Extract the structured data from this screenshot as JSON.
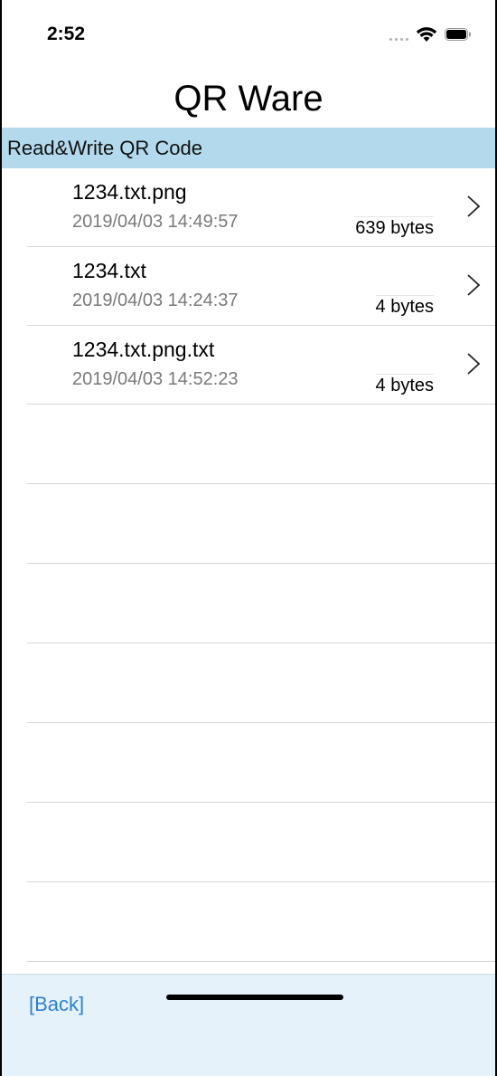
{
  "status_bar": {
    "time": "2:52"
  },
  "nav": {
    "title": "QR Ware"
  },
  "section": {
    "header": "Read&Write QR Code"
  },
  "files": [
    {
      "name": "1234.txt.png",
      "date": "2019/04/03  14:49:57",
      "size": "639 bytes"
    },
    {
      "name": "1234.txt",
      "date": "2019/04/03  14:24:37",
      "size": "4 bytes"
    },
    {
      "name": "1234.txt.png.txt",
      "date": "2019/04/03  14:52:23",
      "size": "4 bytes"
    }
  ],
  "toolbar": {
    "back_label": "[Back]"
  },
  "colors": {
    "section_bg": "#b3daec",
    "toolbar_bg": "#e5f2f9",
    "link": "#2d7fd6"
  }
}
